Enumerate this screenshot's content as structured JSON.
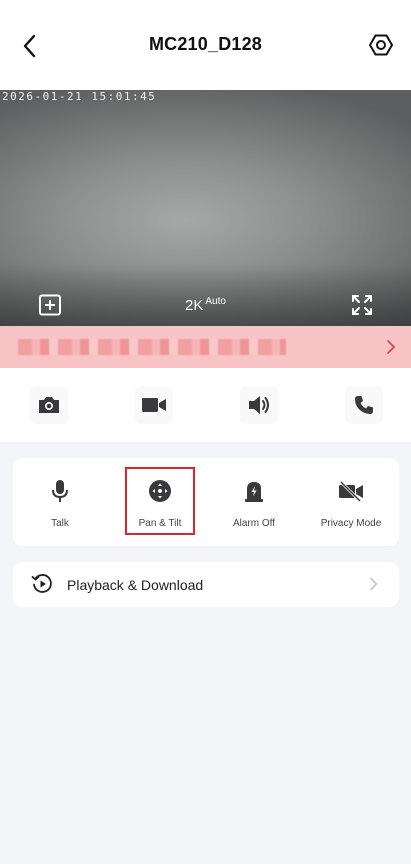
{
  "header": {
    "title": "MC210_D128"
  },
  "video": {
    "timestamp": "2026-01-21  15:01:45",
    "quality": "2K",
    "quality_mode": "Auto"
  },
  "alert_banner": {
    "text": "███ ████ ██ ███ ██████",
    "color": "#f8c3c4"
  },
  "quick_actions": [
    {
      "icon": "camera-icon"
    },
    {
      "icon": "video-record-icon"
    },
    {
      "icon": "speaker-icon"
    },
    {
      "icon": "phone-icon"
    }
  ],
  "controls": [
    {
      "label": "Talk",
      "icon": "microphone-icon"
    },
    {
      "label": "Pan & Tilt",
      "icon": "pan-tilt-icon"
    },
    {
      "label": "Alarm Off",
      "icon": "alarm-icon"
    },
    {
      "label": "Privacy Mode",
      "icon": "camera-off-icon"
    }
  ],
  "playback": {
    "label": "Playback & Download"
  },
  "colors": {
    "highlight": "#d9262b",
    "background": "#f4f5f8",
    "icon": "#3a3a3c"
  }
}
